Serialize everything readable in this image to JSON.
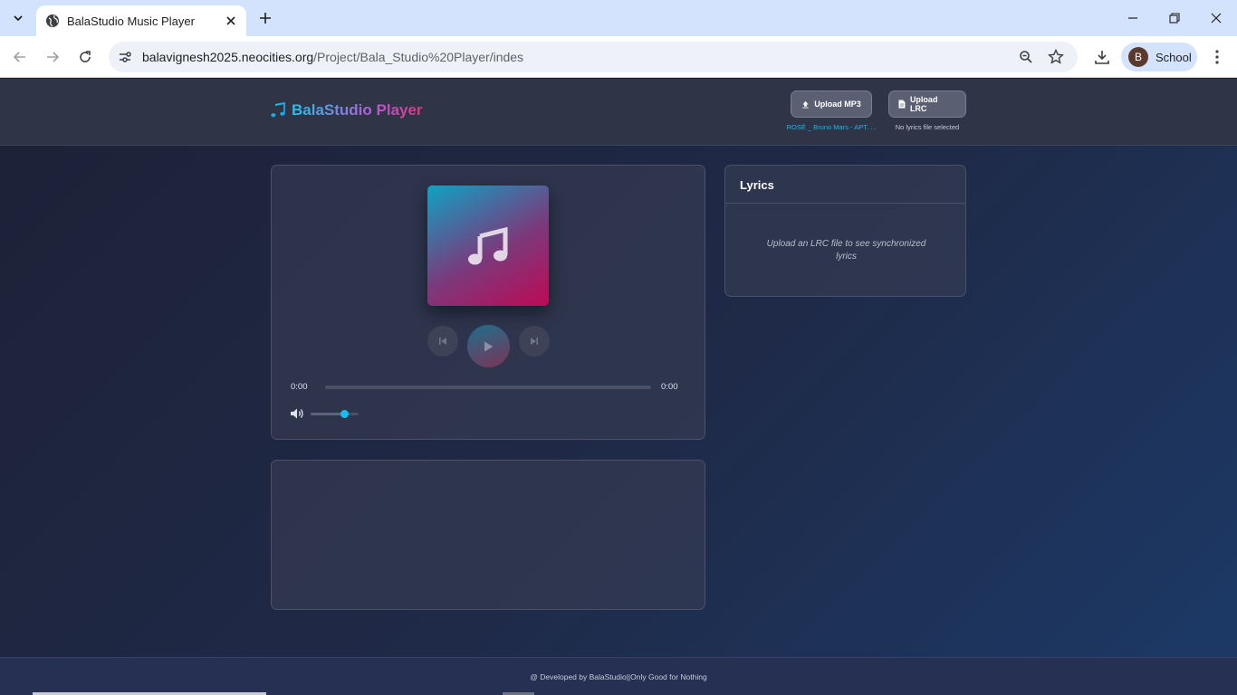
{
  "browser": {
    "tab": {
      "title": "BalaStudio Music Player"
    },
    "url_host": "balavignesh2025.neocities.org",
    "url_path": "/Project/Bala_Studio%20Player/indes",
    "profile": {
      "initial": "B",
      "name": "School"
    }
  },
  "header": {
    "logo_text": "BalaStudio Player",
    "upload_mp3": {
      "label": "Upload MP3",
      "status": "ROSÉ _ Bruno Mars - APT. ...",
      "status_color": "#18b8ef"
    },
    "upload_lrc": {
      "label": "Upload LRC",
      "status": "No lyrics file selected",
      "status_color": "#c7ccd6"
    }
  },
  "player": {
    "current_time": "0:00",
    "duration": "0:00",
    "progress": 0,
    "volume": 0.7
  },
  "lyrics": {
    "title": "Lyrics",
    "placeholder": "Upload an LRC file to see synchronized lyrics"
  },
  "footer": {
    "text": "@ Developed by BalaStudio||Only Good for Nothing"
  },
  "colors": {
    "accent": "#14bef0",
    "brand_pink": "#e0357e"
  },
  "icons": {
    "tab_favicon": "globe-icon",
    "logo": "music-note-icon",
    "album_art": "music-note-icon",
    "prev": "skip-back-icon",
    "play": "play-icon",
    "next": "skip-forward-icon",
    "volume": "volume-icon",
    "upload_mp3": "upload-icon",
    "upload_lrc": "file-icon"
  }
}
